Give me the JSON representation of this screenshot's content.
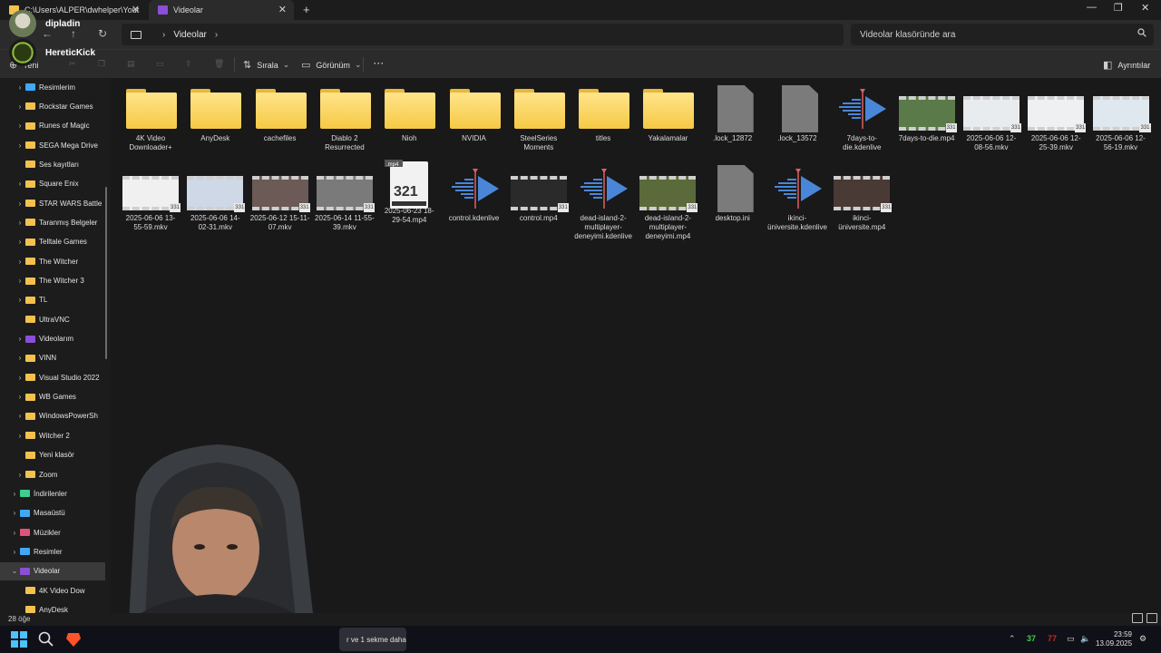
{
  "tabs": [
    {
      "label": "C:\\Users\\ALPER\\dwhelper\\Yout"
    },
    {
      "label": "Videolar"
    }
  ],
  "overlay": {
    "user1": "dipladin",
    "user2": "HereticKick"
  },
  "address": {
    "breadcrumb": "Videolar"
  },
  "search": {
    "placeholder": "Videolar klasöründe ara"
  },
  "toolbar": {
    "new_label": "Yeni",
    "sort_label": "Sırala",
    "view_label": "Görünüm",
    "more_label": "···",
    "details_label": "Ayrıntılar"
  },
  "sidebar": {
    "items": [
      {
        "label": "Resimlerim",
        "icon": "image-icon"
      },
      {
        "label": "Rockstar Games",
        "icon": "folder-icon"
      },
      {
        "label": "Runes of Magic",
        "icon": "folder-icon"
      },
      {
        "label": "SEGA Mega Drive",
        "icon": "folder-icon"
      },
      {
        "label": "Ses kayıtları",
        "icon": "folder-icon"
      },
      {
        "label": "Square Enix",
        "icon": "folder-icon"
      },
      {
        "label": "STAR WARS Battle",
        "icon": "folder-icon"
      },
      {
        "label": "Taranmış Belgeler",
        "icon": "folder-icon"
      },
      {
        "label": "Telltale Games",
        "icon": "folder-icon"
      },
      {
        "label": "The Witcher",
        "icon": "folder-icon"
      },
      {
        "label": "The Witcher 3",
        "icon": "folder-icon"
      },
      {
        "label": "TL",
        "icon": "folder-icon"
      },
      {
        "label": "UltraVNC",
        "icon": "folder-icon"
      },
      {
        "label": "Videolarım",
        "icon": "video-folder-icon"
      },
      {
        "label": "VINN",
        "icon": "folder-icon"
      },
      {
        "label": "Visual Studio 2022",
        "icon": "folder-icon"
      },
      {
        "label": "WB Games",
        "icon": "folder-icon"
      },
      {
        "label": "WindowsPowerSh",
        "icon": "folder-icon"
      },
      {
        "label": "Witcher 2",
        "icon": "folder-icon"
      },
      {
        "label": "Yeni klasör",
        "icon": "folder-icon"
      },
      {
        "label": "Zoom",
        "icon": "folder-icon"
      },
      {
        "label": "İndirilenler",
        "icon": "download-icon"
      },
      {
        "label": "Masaüstü",
        "icon": "desktop-icon"
      },
      {
        "label": "Müzikler",
        "icon": "music-icon"
      },
      {
        "label": "Resimler",
        "icon": "pictures-icon"
      },
      {
        "label": "Videolar",
        "icon": "videos-icon"
      },
      {
        "label": "4K Video Dow",
        "icon": "folder-icon"
      },
      {
        "label": "AnyDesk",
        "icon": "folder-icon"
      }
    ]
  },
  "files": [
    {
      "name": "4K Video Downloader+",
      "type": "folder"
    },
    {
      "name": "AnyDesk",
      "type": "folder"
    },
    {
      "name": "cachefiles",
      "type": "folder"
    },
    {
      "name": "Diablo 2 Resurrected",
      "type": "folder"
    },
    {
      "name": "Nioh",
      "type": "folder"
    },
    {
      "name": "NVIDIA",
      "type": "folder"
    },
    {
      "name": "SteelSeries Moments",
      "type": "folder"
    },
    {
      "name": "titles",
      "type": "folder"
    },
    {
      "name": "Yakalamalar",
      "type": "folder"
    },
    {
      "name": ".lock_12872",
      "type": "doc"
    },
    {
      "name": ".lock_13572",
      "type": "doc"
    },
    {
      "name": "7days-to-die.kdenlive",
      "type": "kdenlive"
    },
    {
      "name": "7days-to-die.mp4",
      "type": "video"
    },
    {
      "name": "2025-06-06 12-08-56.mkv",
      "type": "video"
    },
    {
      "name": "2025-06-06 12-25-39.mkv",
      "type": "video"
    },
    {
      "name": "2025-06-06 12-56-19.mkv",
      "type": "video"
    },
    {
      "name": "2025-06-06 13-55-59.mkv",
      "type": "video"
    },
    {
      "name": "2025-06-06 14-02-31.mkv",
      "type": "video"
    },
    {
      "name": "2025-06-12 15-11-07.mkv",
      "type": "video"
    },
    {
      "name": "2025-06-14 11-55-39.mkv",
      "type": "video"
    },
    {
      "name": "2025-06-23 18-29-54.mp4",
      "type": "mp4"
    },
    {
      "name": "control.kdenlive",
      "type": "kdenlive"
    },
    {
      "name": "control.mp4",
      "type": "video"
    },
    {
      "name": "dead-island-2-multiplayer-deneyimi.kdenlive",
      "type": "kdenlive"
    },
    {
      "name": "dead-island-2-multiplayer-deneyimi.mp4",
      "type": "video"
    },
    {
      "name": "desktop.ini",
      "type": "doc"
    },
    {
      "name": "ikinci-üniversite.kdenlive",
      "type": "kdenlive"
    },
    {
      "name": "ikinci-üniversite.mp4",
      "type": "video"
    }
  ],
  "status": {
    "count": "28 öğe"
  },
  "taskbar": {
    "app_label": "r ve 1 sekme daha",
    "tray_green": "37",
    "tray_red": "77",
    "time": "23:59",
    "date": "13.09.2025"
  },
  "colors": {
    "folder": "#f6c944",
    "accent": "#0078d4",
    "kdenlive_blue": "#3f7fd0"
  }
}
